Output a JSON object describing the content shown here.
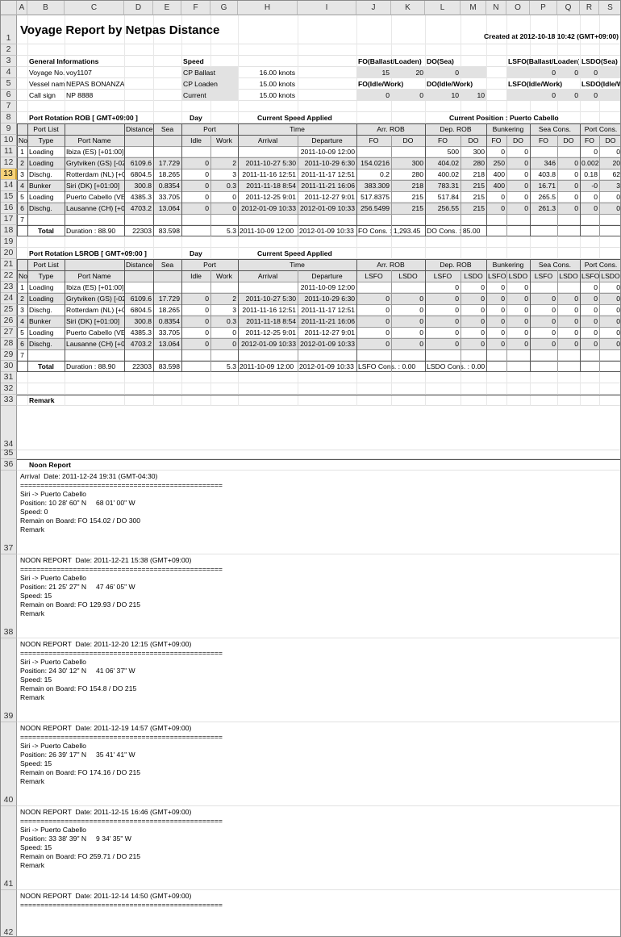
{
  "title": "Voyage Report by Netpas Distance",
  "created": "Created at 2012-10-18 10:42 (GMT+09:00)",
  "columns": [
    "A",
    "B",
    "C",
    "D",
    "E",
    "F",
    "G",
    "H",
    "I",
    "J",
    "K",
    "L",
    "M",
    "N",
    "O",
    "P",
    "Q",
    "R",
    "S"
  ],
  "general": {
    "heading": "General Informations",
    "voyage_label": "Voyage No.",
    "voyage": "voy1107",
    "vessel_label": "Vessel name",
    "vessel": "NEPAS BONANZA",
    "call_label": "Call sign",
    "call": "NP 8888"
  },
  "speed": {
    "heading": "Speed",
    "ballast_label": "CP Ballast",
    "ballast": "16.00 knots",
    "loaden_label": "CP Loaden",
    "loaden": "15.00 knots",
    "current_label": "Current",
    "current": "15.00 knots"
  },
  "cons": {
    "fo_bl": "FO(Ballast/Loaden)",
    "do_sea": "DO(Sea)",
    "lsfo_bl": "LSFO(Ballast/Loaden)",
    "lsdo_sea": "LSDO(Sea)",
    "fo_iw": "FO(Idle/Work)",
    "do_iw": "DO(Idle/Work)",
    "lsfo_iw": "LSFO(Idle/Work)",
    "lsdo_iw": "LSDO(Idle/Work)",
    "fo_b": "15",
    "fo_l": "20",
    "do_s": "0",
    "lsfo_b": "0",
    "lsfo_l": "0",
    "lsdo_s": "0",
    "fo_i": "0",
    "fo_w": "0",
    "do_i": "10",
    "do_w": "10",
    "lsfo_i": "0",
    "lsfo_w": "0",
    "lsdo_i": "0"
  },
  "t1": {
    "title": "Port Rotation ROB [ GMT+09:00 ]",
    "day": "Day",
    "csa": "Current Speed Applied",
    "pos": "Current Position : Puerto Cabello",
    "h1": [
      "No",
      "Type",
      "Port List",
      "Distance",
      "Sea",
      "Port",
      "",
      "Time",
      "",
      "Arr. ROB",
      "",
      "Dep. ROB",
      "",
      "Bunkering",
      "",
      "Sea Cons.",
      "",
      "Port Cons.",
      ""
    ],
    "h2": [
      "",
      "",
      "Port Name",
      "",
      "",
      "Idle",
      "Work",
      "Arrival",
      "Departure",
      "FO",
      "DO",
      "FO",
      "DO",
      "FO",
      "DO",
      "FO",
      "DO",
      "FO",
      "DO"
    ],
    "rows": [
      [
        "1",
        "Loading",
        "Ibiza (ES) [+01:00]",
        "",
        "",
        "",
        "",
        "",
        "2011-10-09 12:00",
        "",
        "",
        "500",
        "300",
        "0",
        "0",
        "",
        "",
        "0",
        "0"
      ],
      [
        "2",
        "Loading",
        "Grytviken (GS) [-02:",
        "6109.6",
        "17.729",
        "0",
        "2",
        "2011-10-27 5:30",
        "2011-10-29 6:30",
        "154.0216",
        "300",
        "404.02",
        "280",
        "250",
        "0",
        "346",
        "0",
        "0.002",
        "20"
      ],
      [
        "3",
        "Dischg.",
        "Rotterdam (NL) [+01",
        "6804.5",
        "18.265",
        "0",
        "3",
        "2011-11-16 12:51",
        "2011-11-17 12:51",
        "0.2",
        "280",
        "400.02",
        "218",
        "400",
        "0",
        "403.8",
        "0",
        "0.18",
        "62"
      ],
      [
        "4",
        "Bunker",
        "Siri (DK) [+01:00]",
        "300.8",
        "0.8354",
        "0",
        "0.3",
        "2011-11-18 8:54",
        "2011-11-21 16:06",
        "383.309",
        "218",
        "783.31",
        "215",
        "400",
        "0",
        "16.71",
        "0",
        "-0",
        "3"
      ],
      [
        "5",
        "Loading",
        "Puerto Cabello (VE)",
        "4385.3",
        "33.705",
        "0",
        "0",
        "2011-12-25 9:01",
        "2011-12-27 9:01",
        "517.8375",
        "215",
        "517.84",
        "215",
        "0",
        "0",
        "265.5",
        "0",
        "0",
        "0"
      ],
      [
        "6",
        "Dischg.",
        "Lausanne (CH) [+01",
        "4703.2",
        "13.064",
        "0",
        "0",
        "2012-01-09 10:33",
        "2012-01-09 10:33",
        "256.5499",
        "215",
        "256.55",
        "215",
        "0",
        "0",
        "261.3",
        "0",
        "0",
        "0"
      ],
      [
        "7",
        "",
        "",
        "",
        "",
        "",
        "",
        "",
        "",
        "",
        "",
        "",
        "",
        "",
        "",
        "",
        "",
        "",
        ""
      ]
    ],
    "total": {
      "label": "Total",
      "duration": "Duration : 88.90",
      "dist": "22303",
      "sea": "83.598",
      "work": "5.3",
      "arr": "2011-10-09 12:00",
      "dep": "2012-01-09 10:33",
      "fo": "FO Cons. : 1,293.45",
      "do": "DO Cons. : 85.00"
    }
  },
  "t2": {
    "title": "Port Rotation LSROB [ GMT+09:00 ]",
    "day": "Day",
    "csa": "Current Speed Applied",
    "h1": [
      "No",
      "Type",
      "Port List",
      "Distance",
      "Sea",
      "Port",
      "",
      "Time",
      "",
      "Arr. ROB",
      "",
      "Dep. ROB",
      "",
      "Bunkering",
      "",
      "Sea Cons.",
      "",
      "Port Cons.",
      ""
    ],
    "h2": [
      "",
      "",
      "Port Name",
      "",
      "",
      "Idle",
      "Work",
      "Arrival",
      "Departure",
      "LSFO",
      "LSDO",
      "LSFO",
      "LSDO",
      "LSFO",
      "LSDO",
      "LSFO",
      "LSDO",
      "LSFO",
      "LSDO"
    ],
    "rows": [
      [
        "1",
        "Loading",
        "Ibiza (ES) [+01:00]",
        "",
        "",
        "",
        "",
        "",
        "2011-10-09 12:00",
        "",
        "",
        "0",
        "0",
        "0",
        "0",
        "",
        "",
        "0",
        "0"
      ],
      [
        "2",
        "Loading",
        "Grytviken (GS) [-02:",
        "6109.6",
        "17.729",
        "0",
        "2",
        "2011-10-27 5:30",
        "2011-10-29 6:30",
        "0",
        "0",
        "0",
        "0",
        "0",
        "0",
        "0",
        "0",
        "0",
        "0"
      ],
      [
        "3",
        "Dischg.",
        "Rotterdam (NL) [+01",
        "6804.5",
        "18.265",
        "0",
        "3",
        "2011-11-16 12:51",
        "2011-11-17 12:51",
        "0",
        "0",
        "0",
        "0",
        "0",
        "0",
        "0",
        "0",
        "0",
        "0"
      ],
      [
        "4",
        "Bunker",
        "Siri (DK) [+01:00]",
        "300.8",
        "0.8354",
        "0",
        "0.3",
        "2011-11-18 8:54",
        "2011-11-21 16:06",
        "0",
        "0",
        "0",
        "0",
        "0",
        "0",
        "0",
        "0",
        "0",
        "0"
      ],
      [
        "5",
        "Loading",
        "Puerto Cabello (VE)",
        "4385.3",
        "33.705",
        "0",
        "0",
        "2011-12-25 9:01",
        "2011-12-27 9:01",
        "0",
        "0",
        "0",
        "0",
        "0",
        "0",
        "0",
        "0",
        "0",
        "0"
      ],
      [
        "6",
        "Dischg.",
        "Lausanne (CH) [+01",
        "4703.2",
        "13.064",
        "0",
        "0",
        "2012-01-09 10:33",
        "2012-01-09 10:33",
        "0",
        "0",
        "0",
        "0",
        "0",
        "0",
        "0",
        "0",
        "0",
        "0"
      ],
      [
        "7",
        "",
        "",
        "",
        "",
        "",
        "",
        "",
        "",
        "",
        "",
        "",
        "",
        "",
        "",
        "",
        "",
        "",
        ""
      ]
    ],
    "total": {
      "label": "Total",
      "duration": "Duration : 88.90",
      "dist": "22303",
      "sea": "83.598",
      "work": "5.3",
      "arr": "2011-10-09 12:00",
      "dep": "2012-01-09 10:33",
      "fo": "LSFO Cons. : 0.00",
      "do": "LSDO Cons. : 0.00"
    }
  },
  "remark": "Remark",
  "noon_heading": "Noon Report",
  "noons": [
    "Arrival  Date: 2011-12-24 19:31 (GMT-04:30)\n==================================================\nSiri -> Puerto Cabello\nPosition: 10 28' 60\" N     68 01' 00\" W\nSpeed: 0\nRemain on Board: FO 154.02 / DO 300\nRemark",
    "NOON REPORT  Date: 2011-12-21 15:38 (GMT+09:00)\n==================================================\nSiri -> Puerto Cabello\nPosition: 21 25' 27\" N     47 46' 05\" W\nSpeed: 15\nRemain on Board: FO 129.93 / DO 215\nRemark",
    "NOON REPORT  Date: 2011-12-20 12:15 (GMT+09:00)\n==================================================\nSiri -> Puerto Cabello\nPosition: 24 30' 12\" N     41 06' 37\" W\nSpeed: 15\nRemain on Board: FO 154.8 / DO 215\nRemark",
    "NOON REPORT  Date: 2011-12-19 14:57 (GMT+09:00)\n==================================================\nSiri -> Puerto Cabello\nPosition: 26 39' 17\" N     35 41' 41\" W\nSpeed: 15\nRemain on Board: FO 174.16 / DO 215\nRemark",
    "NOON REPORT  Date: 2011-12-15 16:46 (GMT+09:00)\n==================================================\nSiri -> Puerto Cabello\nPosition: 33 38' 39\" N     9 34' 35\" W\nSpeed: 15\nRemain on Board: FO 259.71 / DO 215\nRemark",
    "NOON REPORT  Date: 2011-12-14 14:50 (GMT+09:00)\n=================================================="
  ]
}
